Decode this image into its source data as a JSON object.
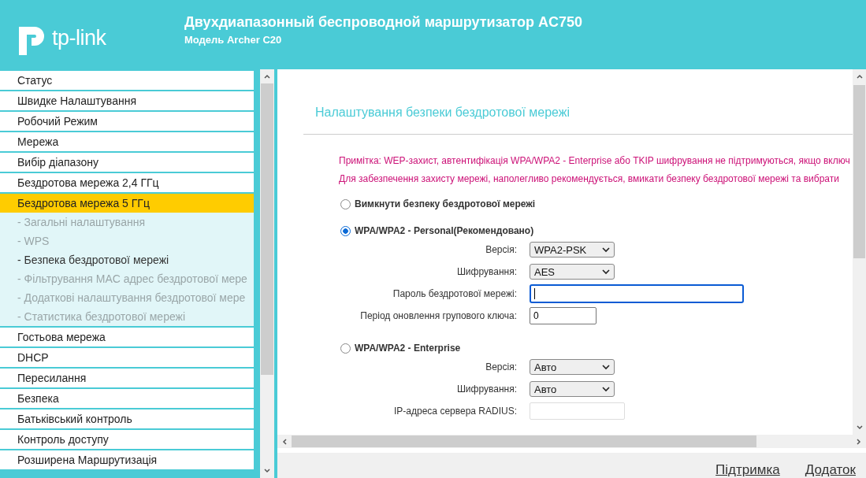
{
  "header": {
    "logo_text": "tp-link",
    "title": "Двухдиапазонный беспроводной маршрутизатор AC750",
    "subtitle": "Модель Archer C20"
  },
  "sidebar": {
    "items": [
      {
        "label": "Статус",
        "selected": false
      },
      {
        "label": "Швидке Налаштування",
        "selected": false
      },
      {
        "label": "Робочий Режим",
        "selected": false
      },
      {
        "label": "Мережа",
        "selected": false
      },
      {
        "label": "Вибір діапазону",
        "selected": false
      },
      {
        "label": "Бездротова мережа 2,4 ГГц",
        "selected": false
      },
      {
        "label": "Бездротова мережа 5 ГГц",
        "selected": true,
        "children": [
          {
            "label": "- Загальні налаштування",
            "selected": false
          },
          {
            "label": "- WPS",
            "selected": false
          },
          {
            "label": "- Безпека бездротової мережі",
            "selected": true
          },
          {
            "label": "- Фільтрування MAC адрес бездротової мере",
            "selected": false
          },
          {
            "label": "- Додаткові налаштування бездротової мере",
            "selected": false
          },
          {
            "label": "- Статистика бездротової мережі",
            "selected": false
          }
        ]
      },
      {
        "label": "Гостьова мережа",
        "selected": false
      },
      {
        "label": "DHCP",
        "selected": false
      },
      {
        "label": "Пересилання",
        "selected": false
      },
      {
        "label": "Безпека",
        "selected": false
      },
      {
        "label": "Батьківський контроль",
        "selected": false
      },
      {
        "label": "Контроль доступу",
        "selected": false
      },
      {
        "label": "Розширена Маршрутизація",
        "selected": false
      }
    ]
  },
  "content": {
    "title": "Налаштування безпеки бездротової мережі",
    "notes": [
      "Примітка: WEP-захист, автентифікація WPA/WPA2 - Enterprise або TKIP шифрування не підтримуються, якщо включ",
      "Для забезпечення захисту мережі, наполегливо рекомендується, вмикати безпеку бездротової мережі та вибрати"
    ],
    "options": [
      {
        "label": "Вимкнути безпеку бездротової мережі",
        "selected": false
      },
      {
        "label": "WPA/WPA2 - Personal(Рекомендовано)",
        "selected": true,
        "fields": [
          {
            "kind": "select",
            "label": "Версія:",
            "value": "WPA2-PSK"
          },
          {
            "kind": "select",
            "label": "Шифрування:",
            "value": "AES"
          },
          {
            "kind": "password",
            "label": "Пароль бездротової мережі:",
            "focused": true
          },
          {
            "kind": "input",
            "label": "Період оновлення групового ключа:",
            "value": "0"
          }
        ]
      },
      {
        "label": "WPA/WPA2 - Enterprise",
        "selected": false,
        "fields": [
          {
            "kind": "select",
            "label": "Версія:",
            "value": "Авто"
          },
          {
            "kind": "select",
            "label": "Шифрування:",
            "value": "Авто"
          },
          {
            "kind": "input",
            "label": "IP-адреса сервера RADIUS:"
          }
        ]
      }
    ]
  },
  "footer": {
    "links": [
      "Підтримка",
      "Додаток"
    ]
  }
}
